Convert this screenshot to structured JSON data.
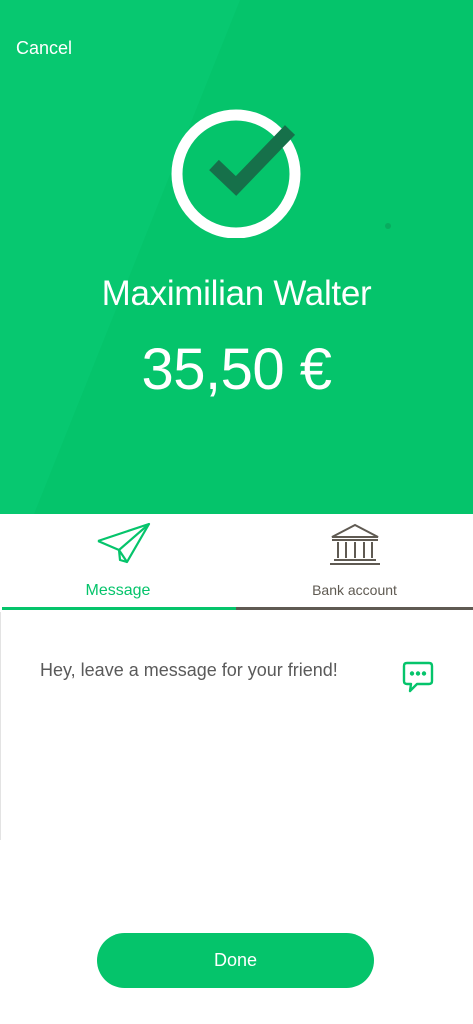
{
  "header": {
    "cancel_label": "Cancel",
    "recipient_name": "Maximilian Walter",
    "amount": "35,50 €"
  },
  "tabs": [
    {
      "label": "Message",
      "icon": "paper-plane-icon",
      "active": true
    },
    {
      "label": "Bank account",
      "icon": "bank-icon",
      "active": false
    }
  ],
  "message": {
    "placeholder": "Hey, leave a message for your friend!",
    "value": "",
    "icon": "chat-bubble-icon"
  },
  "footer": {
    "done_label": "Done"
  },
  "colors": {
    "accent": "#05c46b",
    "check_mark": "#16704a",
    "inactive_tab": "#5f5a52"
  }
}
